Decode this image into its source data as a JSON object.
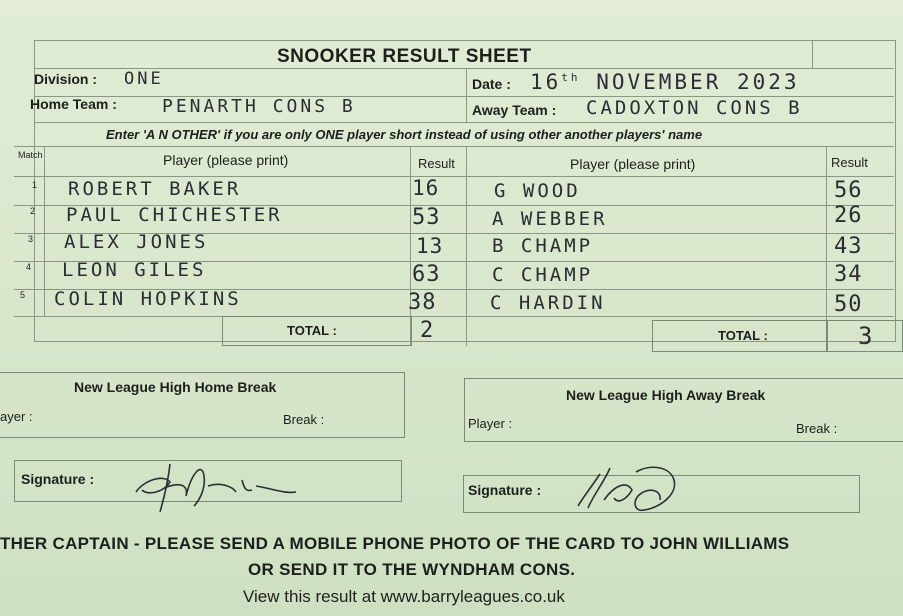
{
  "sheet": {
    "title": "SNOOKER RESULT SHEET",
    "division_label": "Division :",
    "division_value": "ONE",
    "date_label": "Date :",
    "date_day": "16",
    "date_suffix": "th",
    "date_rest": "NOVEMBER  2023",
    "home_label": "Home Team :",
    "home_value": "PENARTH  CONS  B",
    "away_label": "Away Team :",
    "away_value": "CADOXTON  CONS  B",
    "instruction": "Enter 'A N OTHER' if you are only ONE player short instead of using other another players' name",
    "col_match": "Match",
    "col_player_left": "Player (please print)",
    "col_result_left": "Result",
    "col_player_right": "Player (please print)",
    "col_result_right": "Result",
    "rows": [
      {
        "match": "1",
        "home_player": "ROBERT  BAKER",
        "home_score": "16",
        "away_player": "G  WOOD",
        "away_score": "56"
      },
      {
        "match": "2",
        "home_player": "PAUL  CHICHESTER",
        "home_score": "53",
        "away_player": "A  WEBBER",
        "away_score": "26"
      },
      {
        "match": "3",
        "home_player": "ALEX  JONES",
        "home_score": "13",
        "away_player": "B  CHAMP",
        "away_score": "43"
      },
      {
        "match": "4",
        "home_player": "LEON  GILES",
        "home_score": "63",
        "away_player": "C  CHAMP",
        "away_score": "34"
      },
      {
        "match": "5",
        "home_player": "COLIN  HOPKINS",
        "home_score": "38",
        "away_player": "C  HARDIN",
        "away_score": "50"
      }
    ],
    "total_label": "TOTAL :",
    "home_total": "2",
    "away_total": "3",
    "home_break_title": "New League High Home Break",
    "home_break_player": "ayer :",
    "home_break_label": "Break :",
    "away_break_title": "New League High Away Break",
    "away_break_player": "Player :",
    "away_break_label": "Break :",
    "signature_label": "Signature :",
    "footer_line1": "THER CAPTAIN - PLEASE SEND A MOBILE PHONE PHOTO OF THE CARD TO JOHN WILLIAMS",
    "footer_line2": "OR SEND IT TO THE WYNDHAM CONS.",
    "footer_line3": "View this result at www.barryleagues.co.uk"
  }
}
